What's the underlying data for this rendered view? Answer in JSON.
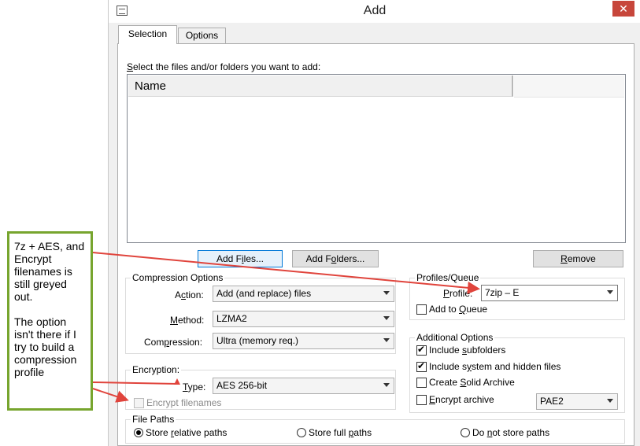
{
  "window": {
    "title": "Add",
    "close_symbol": "✕"
  },
  "tabs": [
    {
      "label": "Selection"
    },
    {
      "label": "Options"
    }
  ],
  "selection_prompt": {
    "prefix": "",
    "underline": "S",
    "rest": "elect the files and/or folders you want to add:"
  },
  "file_list": {
    "column_name": "Name"
  },
  "buttons": {
    "add_files": {
      "pre": "Add F",
      "u": "i",
      "post": "les..."
    },
    "add_folders": {
      "pre": "Add F",
      "u": "o",
      "post": "lders..."
    },
    "remove": {
      "pre": "",
      "u": "R",
      "post": "emove"
    }
  },
  "compression_options": {
    "title": "Compression Options",
    "action": {
      "pre": "A",
      "u": "c",
      "post": "tion:",
      "value": "Add (and replace) files"
    },
    "method": {
      "pre": "",
      "u": "M",
      "post": "ethod:",
      "value": "LZMA2"
    },
    "compression": {
      "pre": "Com",
      "u": "p",
      "post": "ression:",
      "value": "Ultra (memory req.)"
    }
  },
  "encryption": {
    "title": "Encryption:",
    "type": {
      "pre": "",
      "u": "T",
      "post": "ype:",
      "value": "AES 256-bit"
    },
    "encrypt_filenames": {
      "label": "Encrypt filenames",
      "checked": false,
      "disabled": true
    }
  },
  "profiles_queue": {
    "title": "Profiles/Queue",
    "profile": {
      "pre": "",
      "u": "P",
      "post": "rofile:",
      "value": "7zip – E"
    },
    "add_to_queue": {
      "pre": "Add to ",
      "u": "Q",
      "post": "ueue",
      "checked": false
    }
  },
  "additional_options": {
    "title": "Additional Options",
    "include_subfolders": {
      "pre": "Include ",
      "u": "s",
      "post": "ubfolders",
      "checked": true
    },
    "include_system": {
      "pre": "Include s",
      "u": "y",
      "post": "stem and hidden files",
      "checked": true
    },
    "create_solid": {
      "pre": "Create ",
      "u": "S",
      "post": "olid Archive",
      "checked": false
    },
    "encrypt_archive": {
      "pre": "",
      "u": "E",
      "post": "ncrypt archive",
      "checked": false,
      "method_value": "PAE2"
    }
  },
  "file_paths": {
    "title": "File Paths",
    "store_relative": {
      "pre": "Store ",
      "u": "r",
      "post": "elative paths",
      "checked": true
    },
    "store_full": {
      "pre": "Store full ",
      "u": "p",
      "post": "aths",
      "checked": false
    },
    "do_not_store": {
      "pre": "Do ",
      "u": "n",
      "post": "ot store paths",
      "checked": false
    }
  },
  "annotation": {
    "paragraph1": "7z + AES, and Encrypt filenames is still greyed out.",
    "paragraph2": "The option isn't there if I try to build a compression profile",
    "arrow_color": "#e0443c",
    "border_color": "#77a52e"
  }
}
